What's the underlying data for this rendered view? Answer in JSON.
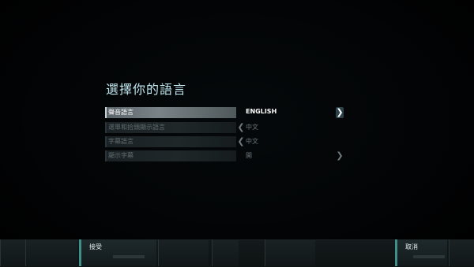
{
  "screen": {
    "title": "選擇你的語言"
  },
  "settings": [
    {
      "label": "聲音語言",
      "value": "ENGLISH",
      "active": true
    },
    {
      "label": "選單和拾頭顯示語言",
      "value": "中文",
      "active": false
    },
    {
      "label": "字幕語言",
      "value": "中文",
      "active": false
    },
    {
      "label": "顯示字幕",
      "value": "開",
      "active": false
    }
  ],
  "footer": {
    "accept_label": "接受",
    "cancel_label": "取消"
  },
  "colors": {
    "title": "#bfe7ef",
    "accent": "#3f8f8a",
    "active_row": "#7a8387"
  }
}
